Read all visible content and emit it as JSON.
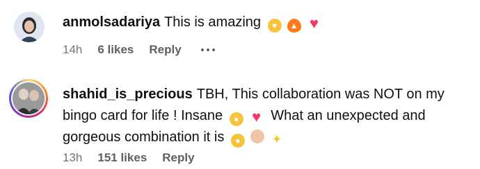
{
  "comments": [
    {
      "username": "anmolsadariya",
      "text": "This is amazing",
      "emojis": [
        "heart-eyes-emoji",
        "fire-emoji",
        "pink-heart-emoji"
      ],
      "time": "14h",
      "likes": "6 likes",
      "reply": "Reply"
    },
    {
      "username": "shahid_is_precious",
      "text_part1": "TBH, This collaboration was NOT on my bingo card for life ! Insane",
      "text_part2": "What an unexpected and gorgeous combination it is",
      "emojis_mid": [
        "screaming-face-emoji",
        "pink-heart-emoji"
      ],
      "emojis_end": [
        "hugging-face-emoji",
        "pinching-hand-emoji",
        "sparkles-emoji"
      ],
      "time": "13h",
      "likes": "151 likes",
      "reply": "Reply"
    }
  ],
  "colors": {
    "text": "#0f0f0f",
    "meta": "#737373",
    "heart": "#f23b64",
    "fire": "#ff7a1a",
    "emoji_yellow": "#f6c33a"
  }
}
